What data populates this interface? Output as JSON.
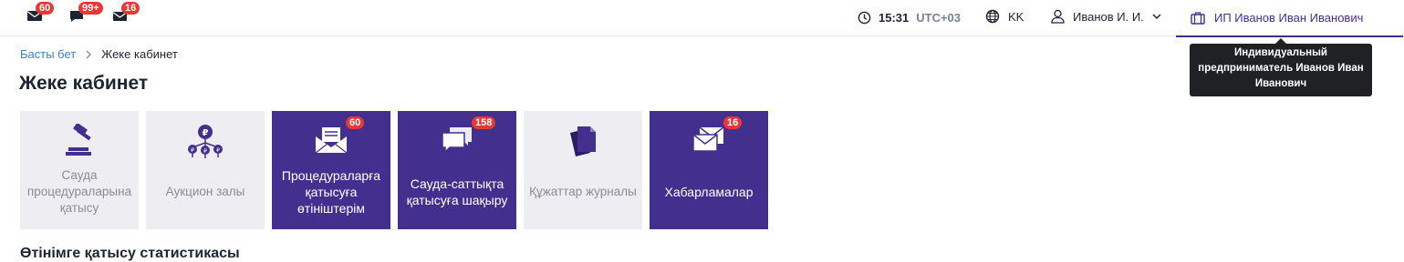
{
  "topbar": {
    "notifications": [
      {
        "icon": "mail-icon",
        "count": "60"
      },
      {
        "icon": "chat-icon",
        "count": "99+"
      },
      {
        "icon": "envelopes-icon",
        "count": "16"
      }
    ],
    "time": "15:31",
    "timezone": "UTC+03",
    "language": "KK",
    "user_name": "Иванов И. И.",
    "organization": "ИП Иванов Иван Иванович",
    "organization_tooltip": "Индивидуальный предприниматель Иванов Иван Иванович"
  },
  "breadcrumb": {
    "home": "Басты бет",
    "current": "Жеке кабинет"
  },
  "page_title": "Жеке кабинет",
  "tiles": [
    {
      "label": "Сауда процедураларына қатысу",
      "icon": "gavel-icon",
      "active": false,
      "badge": ""
    },
    {
      "label": "Аукцион залы",
      "icon": "auction-coins-icon",
      "active": false,
      "badge": ""
    },
    {
      "label": "Процедураларға қатысуға өтініштерім",
      "icon": "letter-icon",
      "active": true,
      "badge": "60"
    },
    {
      "label": "Сауда-саттықта қатысуға шақыру",
      "icon": "chat-bubbles-icon",
      "active": true,
      "badge": "158"
    },
    {
      "label": "Құжаттар журналы",
      "icon": "documents-icon",
      "active": false,
      "badge": ""
    },
    {
      "label": "Хабарламалар",
      "icon": "messages-icon",
      "active": true,
      "badge": "16"
    }
  ],
  "section_title": "Өтінімге қатысу статистикасы",
  "colors": {
    "accent": "#43308e",
    "badge": "#e53935",
    "inactive_tile": "#eeeef2",
    "link": "#3b82c4"
  }
}
